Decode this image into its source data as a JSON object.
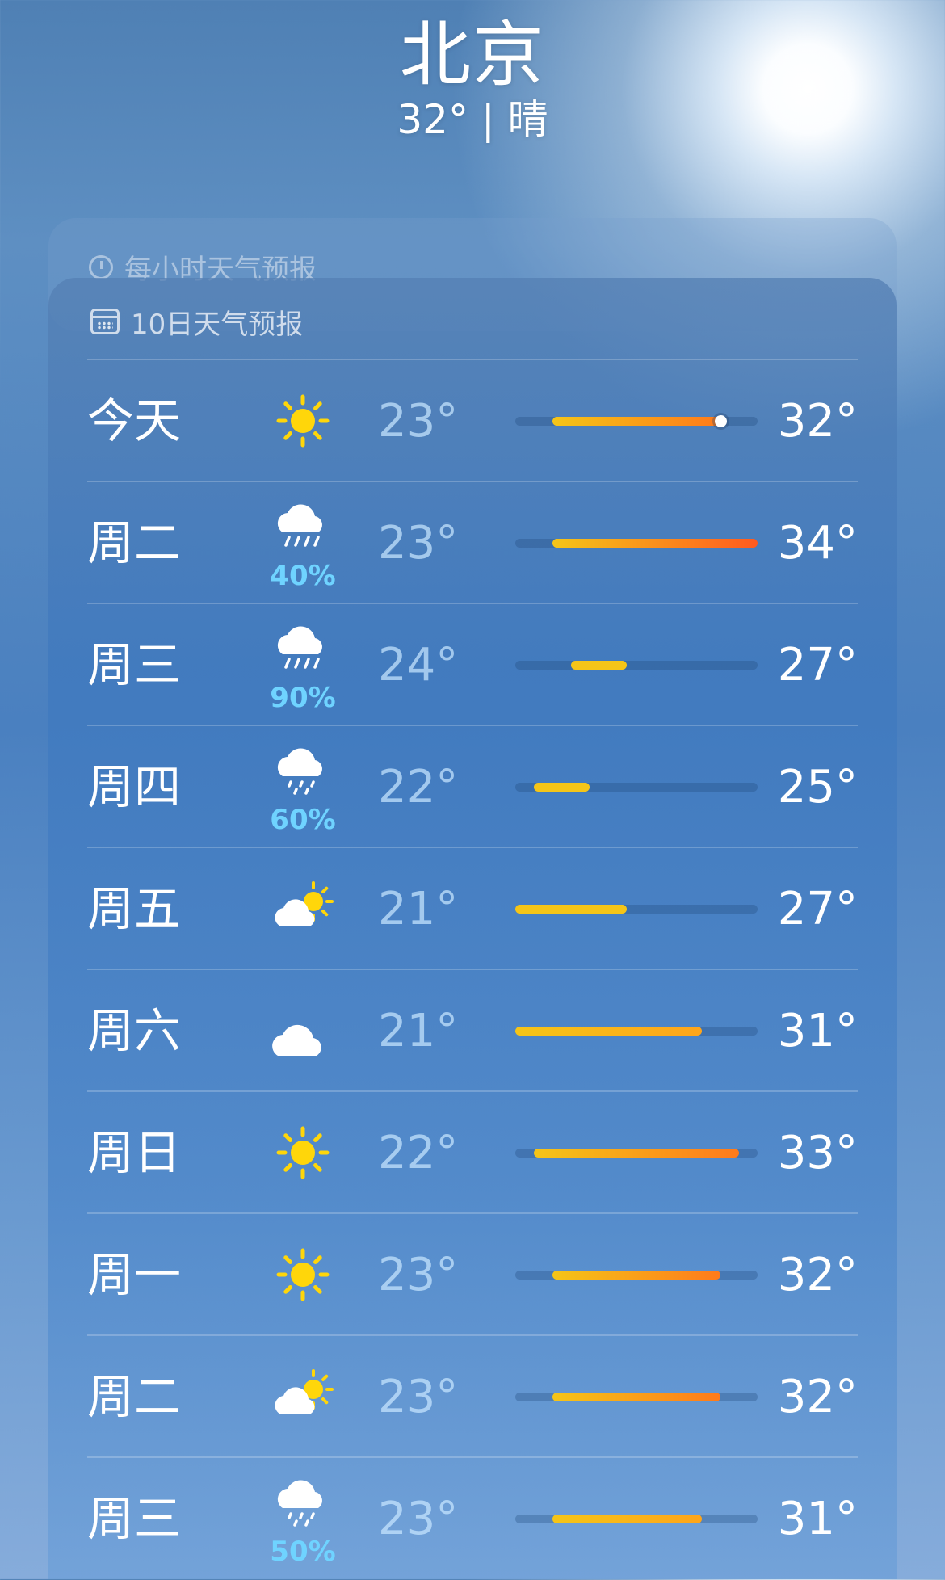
{
  "header": {
    "city": "北京",
    "condition": "32° | 晴"
  },
  "hourly_card": {
    "title": "每小时天气预报",
    "icon": "clock-icon"
  },
  "daily_card": {
    "title": "10日天气预报",
    "icon": "calendar-icon",
    "scale": {
      "min": 21,
      "max": 34
    },
    "current_temp": 32,
    "days": [
      {
        "day": "今天",
        "icon": "sun-icon",
        "precip": "",
        "low": "23°",
        "high": "32°",
        "low_v": 23,
        "high_v": 32,
        "show_current": true
      },
      {
        "day": "周二",
        "icon": "cloud-rain-icon",
        "precip": "40%",
        "low": "23°",
        "high": "34°",
        "low_v": 23,
        "high_v": 34
      },
      {
        "day": "周三",
        "icon": "cloud-rain-icon",
        "precip": "90%",
        "low": "24°",
        "high": "27°",
        "low_v": 24,
        "high_v": 27
      },
      {
        "day": "周四",
        "icon": "cloud-drizzle-icon",
        "precip": "60%",
        "low": "22°",
        "high": "25°",
        "low_v": 22,
        "high_v": 25
      },
      {
        "day": "周五",
        "icon": "partly-cloudy-icon",
        "precip": "",
        "low": "21°",
        "high": "27°",
        "low_v": 21,
        "high_v": 27
      },
      {
        "day": "周六",
        "icon": "cloud-icon",
        "precip": "",
        "low": "21°",
        "high": "31°",
        "low_v": 21,
        "high_v": 31
      },
      {
        "day": "周日",
        "icon": "sun-icon",
        "precip": "",
        "low": "22°",
        "high": "33°",
        "low_v": 22,
        "high_v": 33
      },
      {
        "day": "周一",
        "icon": "sun-icon",
        "precip": "",
        "low": "23°",
        "high": "32°",
        "low_v": 23,
        "high_v": 32
      },
      {
        "day": "周二",
        "icon": "partly-cloudy-icon",
        "precip": "",
        "low": "23°",
        "high": "32°",
        "low_v": 23,
        "high_v": 32
      },
      {
        "day": "周三",
        "icon": "cloud-drizzle-icon",
        "precip": "50%",
        "low": "23°",
        "high": "31°",
        "low_v": 23,
        "high_v": 31
      }
    ]
  },
  "colors": {
    "precip": "#6fd3ff",
    "bar_cool": "#f5c518",
    "bar_warm": "#ff7a1a",
    "bar_hot": "#ff5a1f"
  }
}
